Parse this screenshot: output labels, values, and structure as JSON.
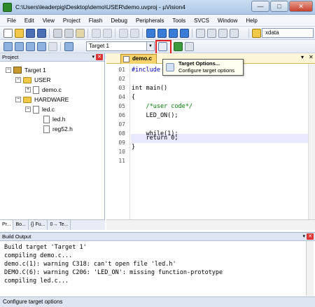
{
  "window": {
    "title": "C:\\Users\\leaderpig\\Desktop\\demo\\USER\\demo.uvproj - µVision4",
    "minimize_label": "—",
    "maximize_label": "□",
    "close_label": "✕"
  },
  "menubar": {
    "items": [
      "File",
      "Edit",
      "View",
      "Project",
      "Flash",
      "Debug",
      "Peripherals",
      "Tools",
      "SVCS",
      "Window",
      "Help"
    ]
  },
  "toolbar": {
    "target_select_value": "Target 1",
    "search_field_value": "xdata"
  },
  "project_panel": {
    "title": "Project",
    "tree": {
      "root": "Target 1",
      "groups": [
        {
          "name": "USER",
          "files": [
            "demo.c"
          ]
        },
        {
          "name": "HARDWARE",
          "files": [
            "led.c"
          ],
          "children": [
            "led.h",
            "reg52.h"
          ]
        }
      ]
    },
    "tabs": [
      "Pr...",
      "Bo...",
      "{} Fu...",
      "0→ Te..."
    ]
  },
  "editor": {
    "active_tab": "demo.c",
    "line_numbers": [
      "01",
      "02",
      "03",
      "04",
      "05",
      "06",
      "07",
      "08",
      "09",
      "10",
      "11"
    ],
    "lines": [
      "#include \"",
      "",
      "int main()",
      "{",
      "    /*user code*/",
      "    LED_ON();",
      "",
      "    while(1);",
      "",
      "    return 0;",
      "}"
    ]
  },
  "tooltip": {
    "title": "Target Options...",
    "subtitle": "Configure target options"
  },
  "build_output": {
    "title": "Build Output",
    "lines": [
      "Build target 'Target 1'",
      "compiling demo.c...",
      "demo.c(1): warning C318: can't open file 'led.h'",
      "DEMO.C(6): warning C206: 'LED_ON': missing function-prototype",
      "compiling led.c..."
    ]
  },
  "statusbar": {
    "text": "Configure target options"
  }
}
